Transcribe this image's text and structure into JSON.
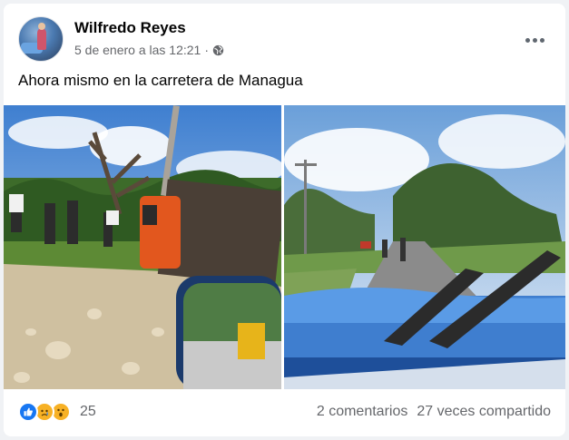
{
  "post": {
    "author": "Wilfredo Reyes",
    "timestamp": "5 de enero a las 12:21",
    "separator": "·",
    "audience_icon": "globe-icon",
    "more_icon": "more-options-icon",
    "text": "Ahora mismo en la carretera de Managua"
  },
  "photos": [
    {
      "icon": "overturned-truck-photo"
    },
    {
      "icon": "road-windshield-photo"
    }
  ],
  "footer": {
    "reactions": [
      "like-icon",
      "sad-icon",
      "wow-icon"
    ],
    "reaction_count": "25",
    "comments": "2 comentarios",
    "shares": "27 veces compartido"
  },
  "colors": {
    "like": "#1877f2",
    "emoji": "#f7b125",
    "secondary_text": "#65676b"
  }
}
